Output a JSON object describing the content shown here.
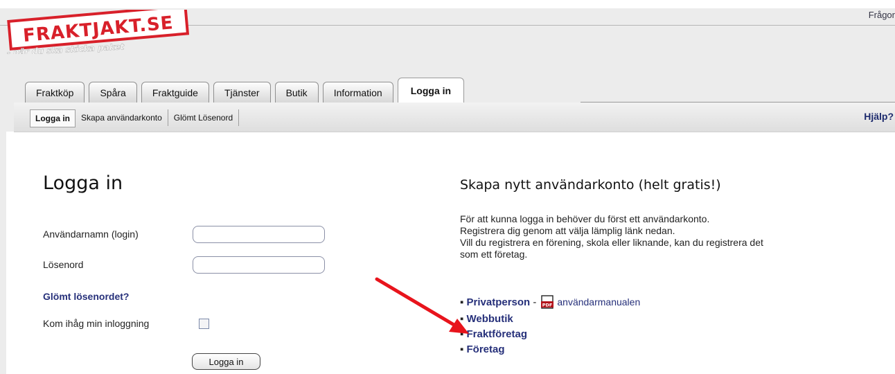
{
  "header": {
    "logo_text": "FRAKTJAKT.SE",
    "logo_tagline": "- när du ska skicka paket",
    "top_link": "Frågor"
  },
  "tabs": [
    "Fraktköp",
    "Spåra",
    "Fraktguide",
    "Tjänster",
    "Butik",
    "Information",
    "Logga in"
  ],
  "active_tab": "Logga in",
  "subnav": {
    "items": [
      "Logga in",
      "Skapa användarkonto",
      "Glömt Lösenord"
    ],
    "help": "Hjälp?"
  },
  "login": {
    "title": "Logga in",
    "username_label": "Användarnamn (login)",
    "username_value": "",
    "password_label": "Lösenord",
    "password_value": "",
    "forgot_link": "Glömt lösenordet?",
    "remember_label": "Kom ihåg min inloggning",
    "remember_checked": false,
    "submit_label": "Logga in"
  },
  "register": {
    "title": "Skapa nytt användarkonto (helt gratis!)",
    "lines": [
      "För att kunna logga in behöver du först ett användarkonto.",
      "Registrera dig genom att välja lämplig länk nedan.",
      "Vill du registrera en förening, skola eller liknande, kan du registrera det",
      "som ett företag."
    ],
    "options": {
      "private": "Privatperson",
      "separator": "-",
      "manual": "användarmanualen",
      "webshop": "Webbutik",
      "freight": "Fraktföretag",
      "company": "Företag"
    },
    "bullet": "▪",
    "pdf_icon_text": "PDF"
  },
  "colors": {
    "link": "#26307a",
    "logo_red": "#d8202a",
    "annotation_arrow": "#e8141c"
  }
}
